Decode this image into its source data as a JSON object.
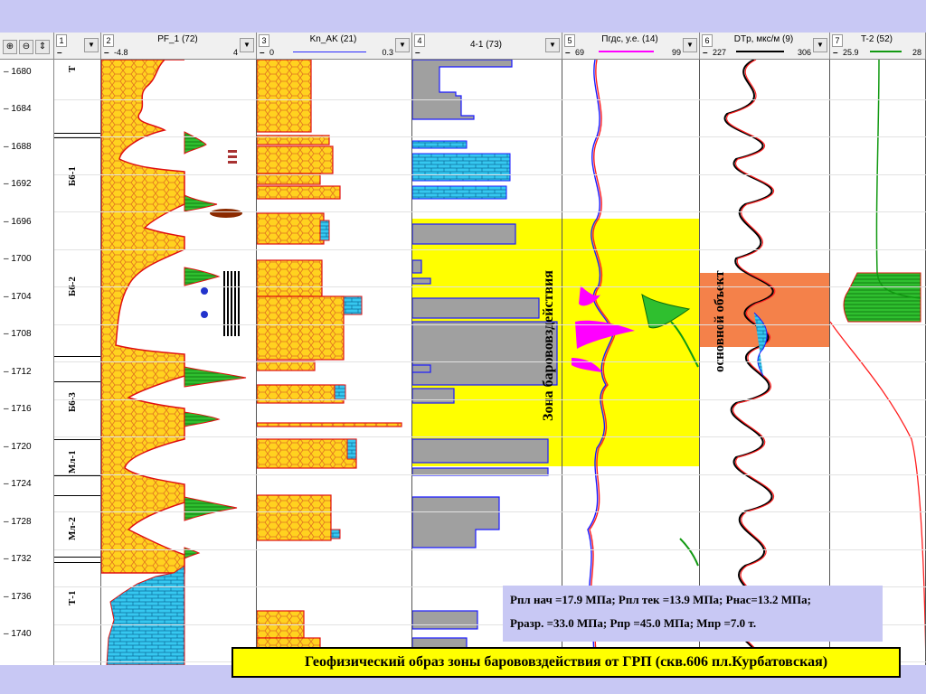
{
  "toolbar": {
    "zoom_in": "⊕",
    "zoom_out": "⊖",
    "scroll": "⇕"
  },
  "headers": {
    "h1": {
      "num": "1",
      "title": ""
    },
    "h2": {
      "num": "2",
      "title": "PF_1 (72)",
      "lo": "-4.8",
      "hi": "4"
    },
    "h3": {
      "num": "3",
      "title": "Kn_AK (21)",
      "lo": "0",
      "hi": "0.3"
    },
    "h4": {
      "num": "4",
      "title": "4-1 (73)"
    },
    "h5": {
      "num": "5",
      "title": "Пгдс, у.е. (14)",
      "lo": "69",
      "hi": "99"
    },
    "h6": {
      "num": "6",
      "title": "DTp, мкс/м (9)",
      "lo": "227",
      "hi": "306"
    },
    "h7": {
      "num": "7",
      "title": "T-2 (52)",
      "lo": "25.9",
      "hi": "28"
    }
  },
  "depth_labels": [
    "– 1680",
    "– 1684",
    "– 1688",
    "– 1692",
    "– 1696",
    "– 1700",
    "– 1704",
    "– 1708",
    "– 1712",
    "– 1716",
    "– 1720",
    "– 1724",
    "– 1728",
    "– 1732",
    "– 1736",
    "– 1740"
  ],
  "strata": {
    "t_top": "Т",
    "b61": "Б6-1",
    "b62": "Б6-2",
    "b63": "Б6-3",
    "ml1": "Мл-1",
    "ml2": "Мл-2",
    "t1": "Т-1"
  },
  "zone_label": "Зона барововздействия",
  "object_label": "основной объект",
  "info": {
    "line1": "Рпл нач =17.9 МПа; Рпл тек =13.9 МПа; Рнас=13.2 МПа;",
    "line2": "Рразр. =33.0 МПа; Рпр =45.0 МПа;  Мпр =7.0 т."
  },
  "caption": "Геофизический образ зоны барововздействия от ГРП (скв.606 пл.Курбатовская)",
  "colors": {
    "background": "#c8c8f4",
    "zone": "#ffff00",
    "object": "#f4814a",
    "lithology_sand": "#ffd21f",
    "lithology_edge": "#e01010",
    "clay_green": "#2fbf2f",
    "carbonate": "#36c8f0",
    "gray_bar": "#a0a0a0"
  }
}
